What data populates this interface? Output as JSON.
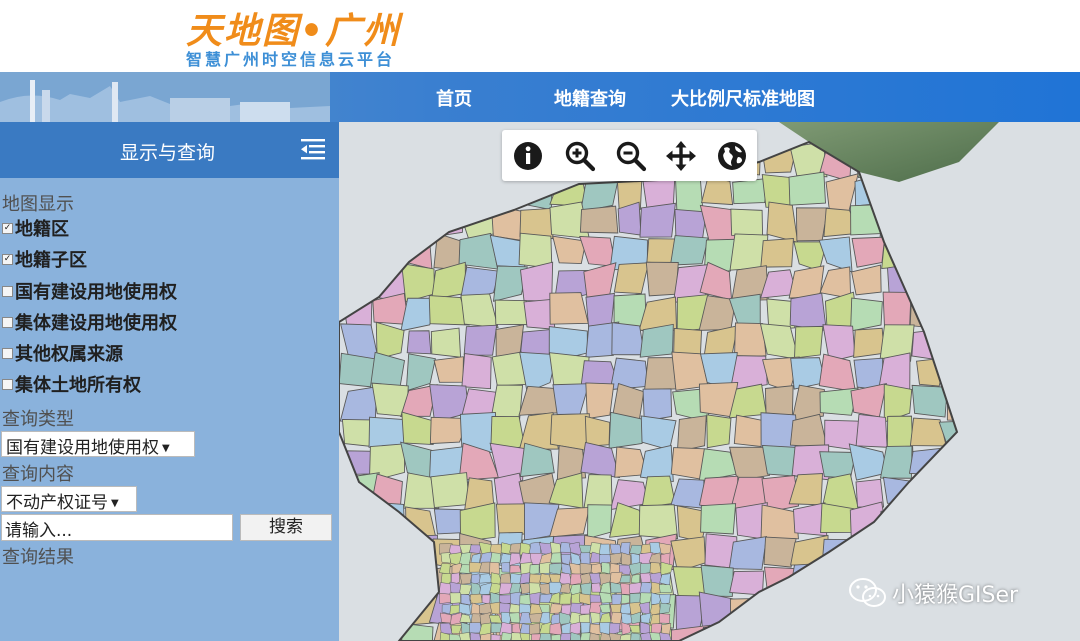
{
  "header": {
    "logo_title": "天地图•广州",
    "logo_subtitle": "智慧广州时空信息云平台"
  },
  "nav": {
    "items": [
      {
        "label": "首页"
      },
      {
        "label": "地籍查询"
      },
      {
        "label": "大比例尺标准地图"
      }
    ]
  },
  "sidebar": {
    "title": "显示与查询",
    "map_display_label": "地图显示",
    "layers": [
      {
        "label": "地籍区",
        "checked": true
      },
      {
        "label": "地籍子区",
        "checked": true
      },
      {
        "label": "国有建设用地使用权",
        "checked": false
      },
      {
        "label": "集体建设用地使用权",
        "checked": false
      },
      {
        "label": "其他权属来源",
        "checked": false
      },
      {
        "label": "集体土地所有权",
        "checked": false
      }
    ],
    "query_type_label": "查询类型",
    "query_type_value": "国有建设用地使用权",
    "query_content_label": "查询内容",
    "query_content_value": "不动产权证号",
    "search_placeholder": "请输入...",
    "search_button": "搜索",
    "results_label": "查询结果"
  },
  "map_toolbar": {
    "tools": [
      {
        "icon": "info-icon"
      },
      {
        "icon": "zoom-in-icon"
      },
      {
        "icon": "zoom-out-icon"
      },
      {
        "icon": "pan-icon"
      },
      {
        "icon": "globe-icon"
      }
    ]
  },
  "watermark": {
    "text": "小猿猴GISer"
  },
  "colors": {
    "accent": "#3a7ac2",
    "sidebar_bg": "#8ab2dc",
    "logo_orange": "#f08c1a",
    "logo_blue": "#3d8fd6"
  }
}
